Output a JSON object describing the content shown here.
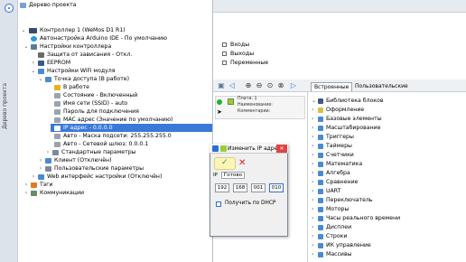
{
  "sidebar_strip": {
    "label": "Дерево проекта"
  },
  "tree": {
    "header": "Дерево проекта",
    "rows": [
      {
        "label": "Контроллер 1 (WeMos D1 R1)"
      },
      {
        "label": "Автонастройка Arduino IDE - По умолчанию"
      },
      {
        "label": "Настройки контроллера"
      },
      {
        "label": "Защита от зависания - Откл."
      },
      {
        "label": "EEPROM"
      },
      {
        "label": "Настройки WiFi модуля"
      },
      {
        "label": "Точка доступа (В работе)"
      },
      {
        "label": "В работе"
      },
      {
        "label": "Состояние - Включенный"
      },
      {
        "label": "Имя сети (SSID) - auto"
      },
      {
        "label": "Пароль для подключения"
      },
      {
        "label": "MAC адрес (Значение по умолчанию)"
      },
      {
        "label": "IP адрес - 0.0.0.0"
      },
      {
        "label": "Авто - Маска подсети: 255.255.255.0"
      },
      {
        "label": "Авто - Сетевой шлюз: 0.0.0.1"
      },
      {
        "label": "Стандартные параметры"
      },
      {
        "label": "Клиент (Отключён)"
      },
      {
        "label": "Пользовательские параметры"
      },
      {
        "label": "Web интерфейс настройки (Отключён)"
      },
      {
        "label": "Тэги"
      },
      {
        "label": "Коммуникации"
      }
    ]
  },
  "io_panel": {
    "inputs": "Входы",
    "outputs": "Выходы",
    "variables": "Переменные"
  },
  "block_info": {
    "board": "Плата: 1",
    "name": "Наименование:",
    "comments": "Комментарии:"
  },
  "library": {
    "tabs": [
      "Встроенные",
      "Пользовательские"
    ],
    "items": [
      "Библиотека блоков",
      "Оформление",
      "Базовые элементы",
      "Масштабирование",
      "Триггеры",
      "Таймеры",
      "Счетчики",
      "Математика",
      "Алгебра",
      "Сравнение",
      "UART",
      "Переключатель",
      "Моторы",
      "Часы реального времени",
      "Дисплеи",
      "Строки",
      "ИК управление",
      "Массивы"
    ]
  },
  "dialog": {
    "title": "Изменить IP адрес",
    "close": "✕",
    "ready": "Готово",
    "ip_label": "IP",
    "octets": [
      "192",
      "168",
      "001",
      "010"
    ],
    "dhcp_label": "Получить по DHCP"
  },
  "colors": {
    "selection": "#3b79d9",
    "accent": "#2a6fd6",
    "ok_bg": "#fbf6b8",
    "close_red": "#e04343"
  }
}
